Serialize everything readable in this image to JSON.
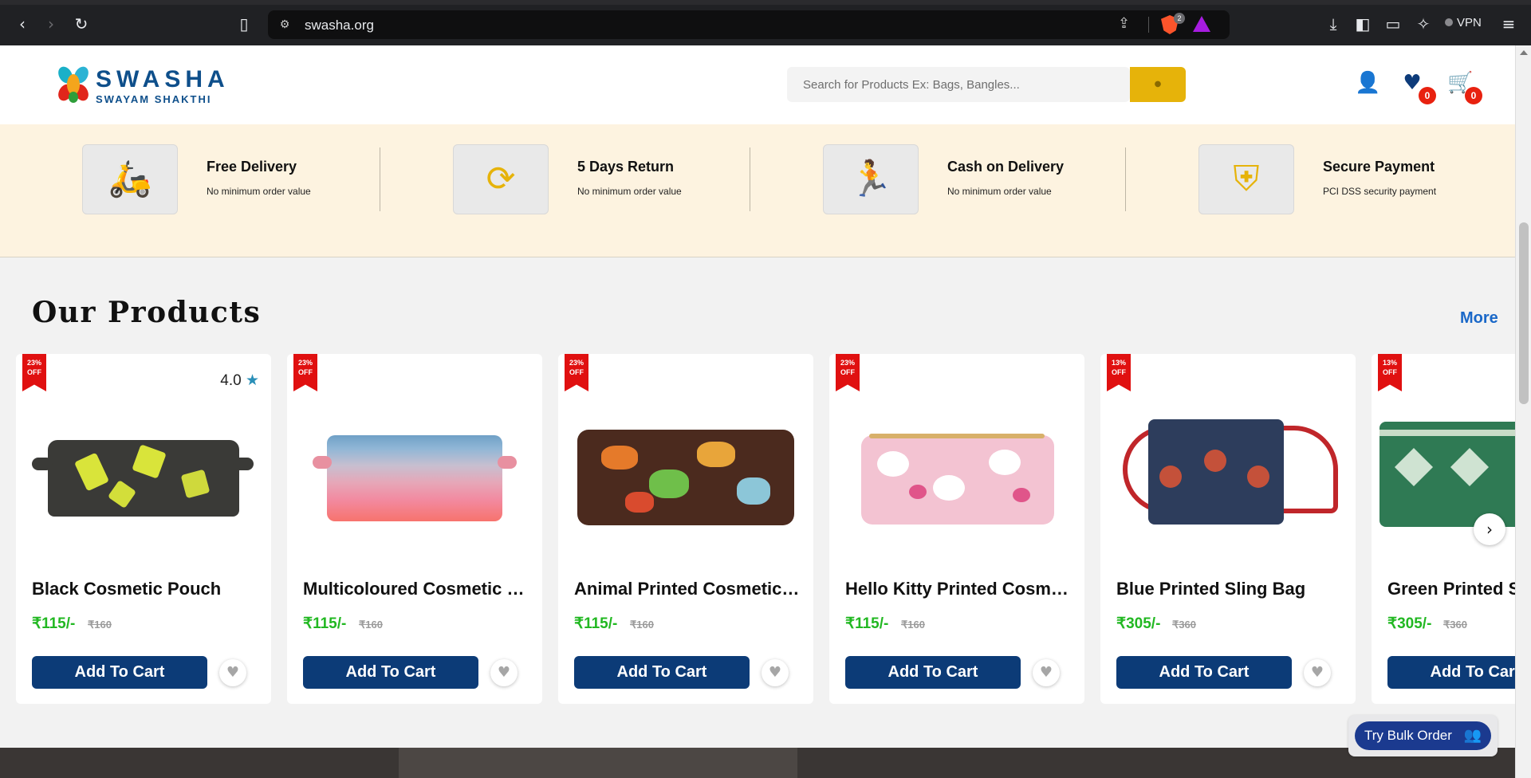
{
  "browser": {
    "url": "swasha.org",
    "shields_count": "2",
    "vpn_label": "VPN"
  },
  "header": {
    "logo_name": "SWASHA",
    "logo_tag": "SWAYAM SHAKTHI",
    "search_placeholder": "Search for Products Ex: Bags, Bangles...",
    "wishlist_count": "0",
    "cart_count": "0"
  },
  "features": [
    {
      "title": "Free Delivery",
      "subtitle": "No minimum order value",
      "icon": "delivery-scooter-icon"
    },
    {
      "title": "5 Days Return",
      "subtitle": "No minimum order value",
      "icon": "return-cycle-icon"
    },
    {
      "title": "Cash on Delivery",
      "subtitle": "No minimum order value",
      "icon": "cash-delivery-icon"
    },
    {
      "title": "Secure Payment",
      "subtitle": "PCI DSS security payment",
      "icon": "shield-check-icon"
    }
  ],
  "products": {
    "title": "Our Products",
    "more_label": "More",
    "add_to_cart_label": "Add To Cart",
    "items": [
      {
        "discount": "23% OFF",
        "rating": "4.0",
        "name": "Black Cosmetic Pouch",
        "price": "₹115/-",
        "mrp": "₹160"
      },
      {
        "discount": "23% OFF",
        "rating": "",
        "name": "Multicoloured Cosmetic Pouch",
        "price": "₹115/-",
        "mrp": "₹160"
      },
      {
        "discount": "23% OFF",
        "rating": "",
        "name": "Animal Printed Cosmetic Pouch",
        "price": "₹115/-",
        "mrp": "₹160"
      },
      {
        "discount": "23% OFF",
        "rating": "",
        "name": "Hello Kitty Printed Cosmetic Pouch",
        "price": "₹115/-",
        "mrp": "₹160"
      },
      {
        "discount": "13% OFF",
        "rating": "",
        "name": "Blue Printed Sling Bag",
        "price": "₹305/-",
        "mrp": "₹360"
      },
      {
        "discount": "13% OFF",
        "rating": "",
        "name": "Green Printed Sling Bag",
        "price": "₹305/-",
        "mrp": "₹360"
      }
    ]
  },
  "bulk_order_label": "Try Bulk Order",
  "colors": {
    "accent_yellow": "#e6b30a",
    "brand_blue": "#0c3b77",
    "price_green": "#22b822",
    "discount_red": "#e01010"
  }
}
